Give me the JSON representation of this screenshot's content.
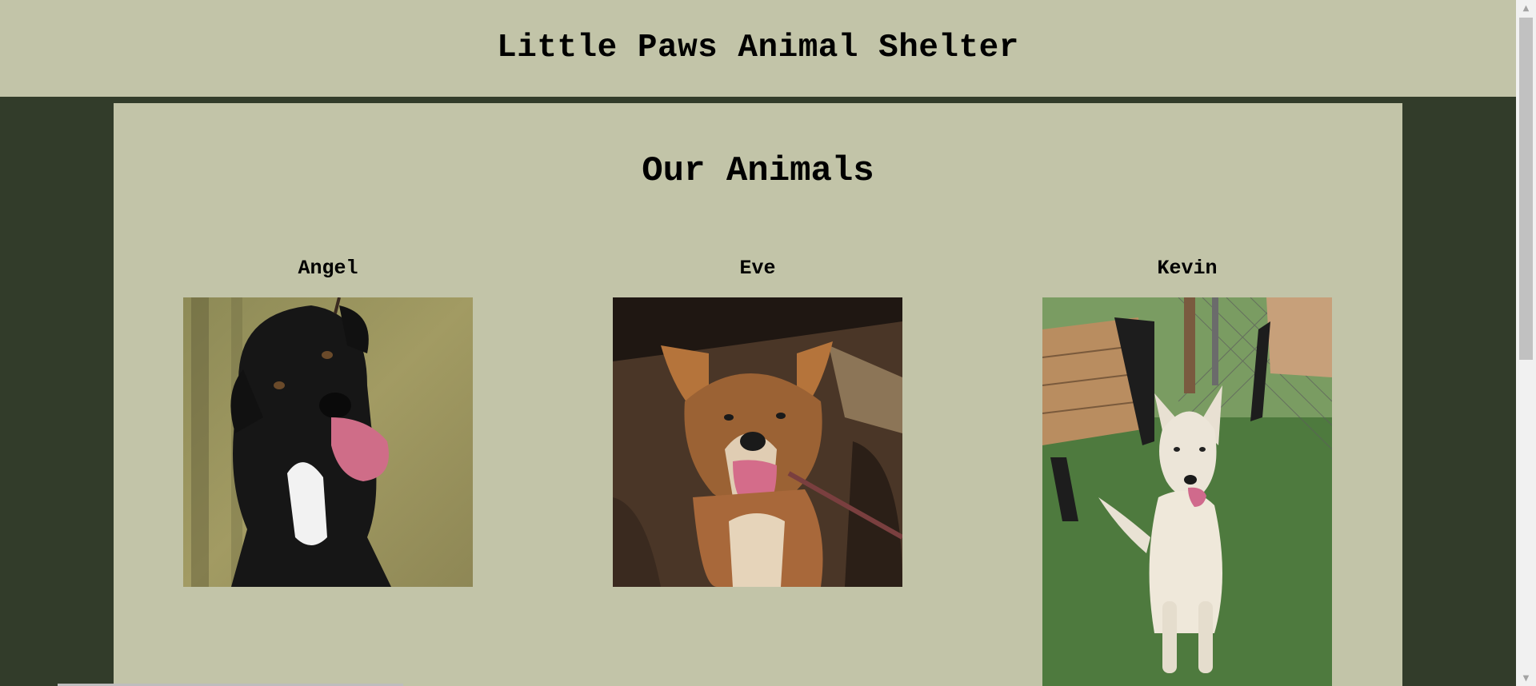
{
  "header": {
    "title": "Little Paws Animal Shelter"
  },
  "main": {
    "section_title": "Our Animals",
    "animals": [
      {
        "name": "Angel",
        "photo_icon": "black-dog-photo"
      },
      {
        "name": "Eve",
        "photo_icon": "brown-dog-photo"
      },
      {
        "name": "Kevin",
        "photo_icon": "white-dog-photo"
      }
    ]
  },
  "colors": {
    "page_background": "#323c2a",
    "panel_background": "#c2c4a8",
    "text": "#000000"
  }
}
